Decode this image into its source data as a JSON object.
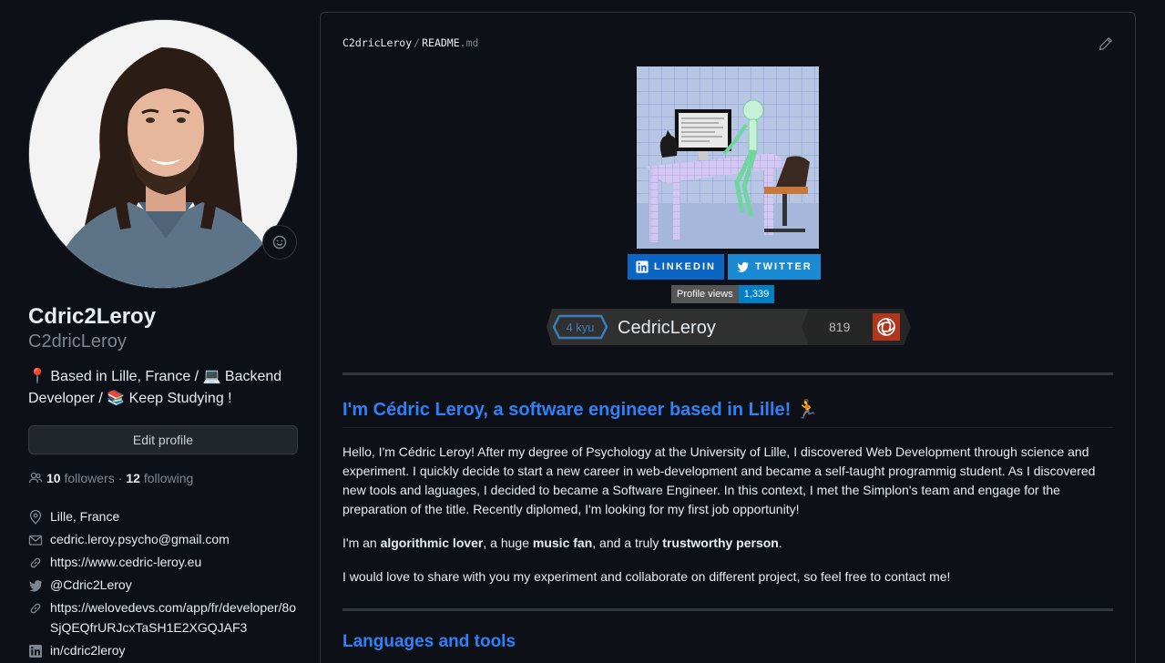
{
  "profile": {
    "display_name": "Cdric2Leroy",
    "username": "C2dricLeroy",
    "bio": "📍 Based in Lille, France / 💻 Backend Developer / 📚 Keep Studying !",
    "edit_button": "Edit profile",
    "followers_count": "10",
    "followers_label": "followers",
    "following_count": "12",
    "following_label": "following",
    "separator": "·",
    "details": [
      {
        "icon": "location-icon",
        "text": "Lille, France"
      },
      {
        "icon": "mail-icon",
        "text": "cedric.leroy.psycho@gmail.com"
      },
      {
        "icon": "link-icon",
        "text": "https://www.cedric-leroy.eu"
      },
      {
        "icon": "twitter-icon",
        "text": "@Cdric2Leroy"
      },
      {
        "icon": "link-icon",
        "text": "https://welovedevs.com/app/fr/developer/8oSjQEQfrURJcxTaSH1E2XGQJAF3"
      },
      {
        "icon": "linkedin-icon",
        "text": "in/cdric2leroy"
      }
    ]
  },
  "readme": {
    "repo": "C2dricLeroy",
    "slash": "/",
    "file": "README",
    "ext": ".md",
    "badges": {
      "linkedin": "LINKEDIN",
      "twitter": "TWITTER",
      "views_label": "Profile views",
      "views_value": "1,339"
    },
    "codewars": {
      "rank": "4 kyu",
      "name": "CedricLeroy",
      "honor": "819"
    },
    "heading1": "I'm Cédric Leroy, a software engineer based in Lille! 🏃",
    "para1": "Hello, I'm Cédric Leroy! After my degree of Psychology at the University of Lille, I discovered Web Development through science and experiment. I quickly decide to start a new career in web-development and became a self-taught programmig student. As I discovered new tools and laguages, I decided to became a Software Engineer. In this context, I met the Simplon's team and engage for the preparation of the title. Recently diplomed, I'm looking for my first job opportunity!",
    "para2": {
      "a": "I'm an ",
      "b": "algorithmic lover",
      "c": ", a huge ",
      "d": "music fan",
      "e": ", and a truly ",
      "f": "trustworthy person",
      "g": "."
    },
    "para3": "I would love to share with you my experiment and collaborate on different project, so feel free to contact me!",
    "heading2": "Languages and tools"
  },
  "colors": {
    "background": "#0d1117",
    "link_heading": "#2f81f7",
    "linkedin": "#0a66c2",
    "twitter": "#1a8ad4",
    "views_value_bg": "#007ec6"
  }
}
